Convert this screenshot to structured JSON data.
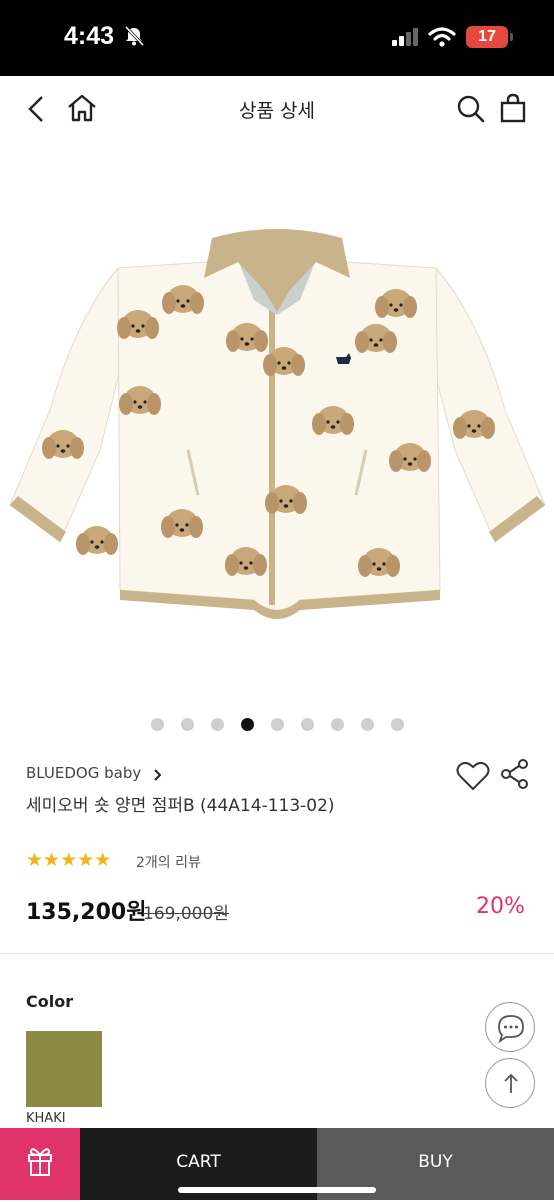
{
  "status_bar": {
    "time": "4:43",
    "battery": "17"
  },
  "nav": {
    "title": "상품 상세"
  },
  "product": {
    "brand": "BLUEDOG baby",
    "name": "세미오버 숏 양면 점퍼B (44A14-113-02)",
    "rating_stars": 5,
    "review_text": "2개의 리뷰",
    "price": "135,200원",
    "original_price": "169,000원",
    "discount": "20%"
  },
  "carousel": {
    "total": 9,
    "active_index": 3
  },
  "options": {
    "color_label": "Color",
    "selected_color_name": "KHAKI",
    "selected_color_hex": "#8a8a45"
  },
  "bottom_bar": {
    "cart_label": "CART",
    "buy_label": "BUY"
  },
  "colors": {
    "accent": "#e0336b",
    "star": "#f2b21c"
  }
}
